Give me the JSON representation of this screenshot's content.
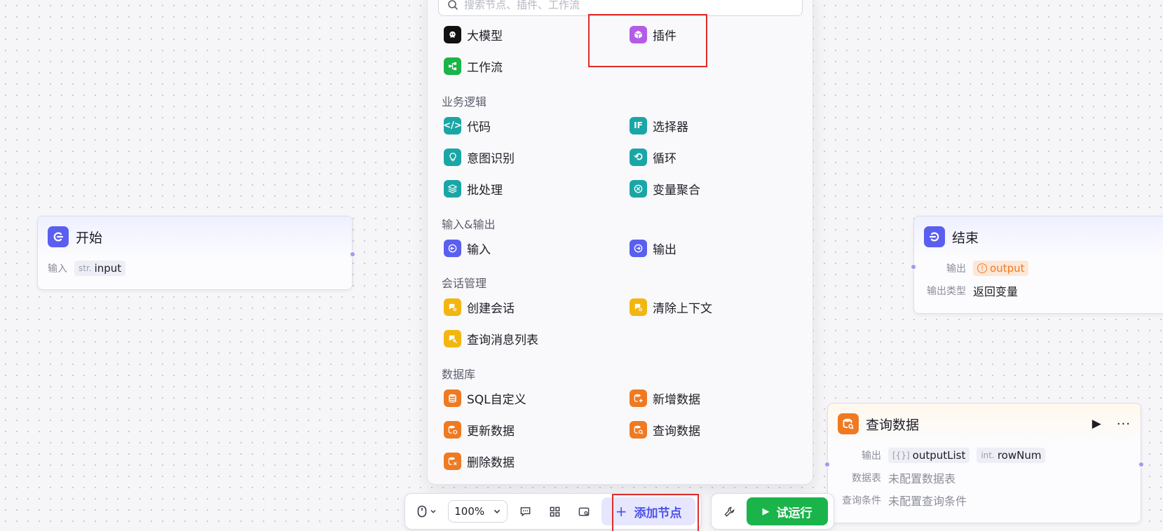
{
  "panel": {
    "search_placeholder": "搜索节点、插件、工作流",
    "top_items": [
      {
        "label": "大模型",
        "icon": "llm-icon",
        "color": "#111111"
      },
      {
        "label": "插件",
        "icon": "plugin-cube-icon",
        "color": "#b45ce6"
      },
      {
        "label": "工作流",
        "icon": "workflow-icon",
        "color": "#1ab44a"
      }
    ],
    "sections": [
      {
        "title": "业务逻辑",
        "items": [
          {
            "label": "代码",
            "icon": "code-icon",
            "color": "#1aa6a6"
          },
          {
            "label": "选择器",
            "icon": "if-selector-icon",
            "color": "#1aa6a6"
          },
          {
            "label": "意图识别",
            "icon": "intent-bulb-icon",
            "color": "#1aa6a6"
          },
          {
            "label": "循环",
            "icon": "loop-icon",
            "color": "#1aa6a6"
          },
          {
            "label": "批处理",
            "icon": "batch-layers-icon",
            "color": "#1aa6a6"
          },
          {
            "label": "变量聚合",
            "icon": "variable-merge-icon",
            "color": "#1aa6a6"
          }
        ]
      },
      {
        "title": "输入&输出",
        "items": [
          {
            "label": "输入",
            "icon": "input-arrow-icon",
            "color": "#5a5ff0"
          },
          {
            "label": "输出",
            "icon": "output-arrow-icon",
            "color": "#5a5ff0"
          }
        ]
      },
      {
        "title": "会话管理",
        "items": [
          {
            "label": "创建会话",
            "icon": "create-chat-icon",
            "color": "#f2b60f"
          },
          {
            "label": "清除上下文",
            "icon": "clear-context-icon",
            "color": "#f2b60f"
          },
          {
            "label": "查询消息列表",
            "icon": "query-messages-icon",
            "color": "#f2b60f"
          }
        ]
      },
      {
        "title": "数据库",
        "items": [
          {
            "label": "SQL自定义",
            "icon": "database-icon",
            "color": "#f07a22"
          },
          {
            "label": "新增数据",
            "icon": "database-add-icon",
            "color": "#f07a22"
          },
          {
            "label": "更新数据",
            "icon": "database-update-icon",
            "color": "#f07a22"
          },
          {
            "label": "查询数据",
            "icon": "database-query-icon",
            "color": "#f07a22"
          },
          {
            "label": "删除数据",
            "icon": "database-delete-icon",
            "color": "#f07a22"
          }
        ]
      }
    ]
  },
  "start_node": {
    "title": "开始",
    "input_label": "输入",
    "input_type": "str.",
    "input_name": "input",
    "icon_color": "#5a5ff0"
  },
  "end_node": {
    "title": "结束",
    "output_label": "输出",
    "output_value": "output",
    "output_type_label": "输出类型",
    "output_type_value": "返回变量",
    "icon_color": "#5a5ff0",
    "warning_color": "#f07a22"
  },
  "query_node": {
    "title": "查询数据",
    "output_label": "输出",
    "outputs": [
      {
        "type": "[{}]",
        "name": "outputList"
      },
      {
        "type": "int.",
        "name": "rowNum"
      }
    ],
    "table_label": "数据表",
    "table_value": "未配置数据表",
    "condition_label": "查询条件",
    "condition_value": "未配置查询条件",
    "icon_color": "#f07a22"
  },
  "toolbar": {
    "zoom": "100%",
    "add_node_label": "添加节点",
    "run_label": "试运行",
    "accent": "#4d53e8",
    "run_color": "#1ab44a"
  }
}
